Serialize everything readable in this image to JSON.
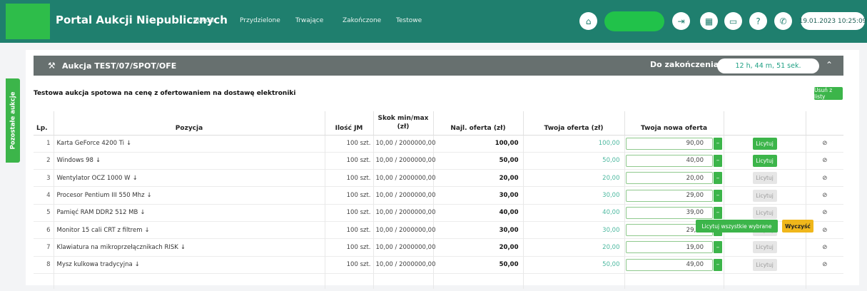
{
  "header": {
    "app_title": "Portal Aukcji Niepublicznych",
    "nav": [
      "Aukcje",
      "Przydzielone",
      "Trwające",
      "Zakończone",
      "Testowe"
    ],
    "datetime": "19.01.2023 10:25:09",
    "icons": [
      "home-icon",
      "logout-icon",
      "calculator-icon",
      "book-icon",
      "help-icon",
      "phone-icon"
    ],
    "colors": {
      "bar": "#1f7f6e",
      "accent": "#3cb54a"
    }
  },
  "side_tab": {
    "label": "Pozostałe aukcje"
  },
  "auction": {
    "title": "Aukcja TEST/07/SPOT/OFE",
    "ends_label": "Do zakończenia",
    "countdown": "12 h, 44 m, 51 sek.",
    "description": "Testowa aukcja spotowa na cenę z ofertowaniem na dostawę elektroniki",
    "remove_label": "Usuń z listy"
  },
  "table": {
    "headers": {
      "lp": "Lp.",
      "pozycja": "Pozycja",
      "ilosc": "Ilość JM",
      "skok": "Skok min/max (zł)",
      "najl": "Najl. oferta (zł)",
      "twoja": "Twoja oferta (zł)",
      "nowa": "Twoja nowa oferta"
    },
    "rows": [
      {
        "lp": "1",
        "name": "Karta GeForce 4200 Ti",
        "qty": "100 szt.",
        "skok": "10,00 / 2000000,00",
        "best": "100,00",
        "mine": "100,00",
        "new_bid": "90,00",
        "bid_label": "Licytuj",
        "bid_enabled": true
      },
      {
        "lp": "2",
        "name": "Windows 98",
        "qty": "100 szt.",
        "skok": "10,00 / 2000000,00",
        "best": "50,00",
        "mine": "50,00",
        "new_bid": "40,00",
        "bid_label": "Licytuj",
        "bid_enabled": true
      },
      {
        "lp": "3",
        "name": "Wentylator OCZ 1000 W",
        "qty": "100 szt.",
        "skok": "10,00 / 2000000,00",
        "best": "20,00",
        "mine": "20,00",
        "new_bid": "20,00",
        "bid_label": "Licytuj",
        "bid_enabled": false
      },
      {
        "lp": "4",
        "name": "Procesor Pentium III 550 Mhz",
        "qty": "100 szt.",
        "skok": "10,00 / 2000000,00",
        "best": "30,00",
        "mine": "30,00",
        "new_bid": "29,00",
        "bid_label": "Licytuj",
        "bid_enabled": false
      },
      {
        "lp": "5",
        "name": "Pamięć RAM DDR2 512 MB",
        "qty": "100 szt.",
        "skok": "10,00 / 2000000,00",
        "best": "40,00",
        "mine": "40,00",
        "new_bid": "39,00",
        "bid_label": "Licytuj",
        "bid_enabled": false
      },
      {
        "lp": "6",
        "name": "Monitor 15 cali CRT z filtrem",
        "qty": "100 szt.",
        "skok": "10,00 / 2000000,00",
        "best": "30,00",
        "mine": "30,00",
        "new_bid": "29,00",
        "bid_label": "Licytuj",
        "bid_enabled": false
      },
      {
        "lp": "7",
        "name": "Klawiatura na mikroprzełącznikach RISK",
        "qty": "100 szt.",
        "skok": "10,00 / 2000000,00",
        "best": "20,00",
        "mine": "20,00",
        "new_bid": "19,00",
        "bid_label": "Licytuj",
        "bid_enabled": false
      },
      {
        "lp": "8",
        "name": "Mysz kulkowa tradycyjna",
        "qty": "100 szt.",
        "skok": "10,00 / 2000000,00",
        "best": "50,00",
        "mine": "50,00",
        "new_bid": "49,00",
        "bid_label": "Licytuj",
        "bid_enabled": false
      }
    ],
    "bid_all_label": "Licytuj wszystkie wybrane",
    "clear_label": "Wyczyść"
  }
}
